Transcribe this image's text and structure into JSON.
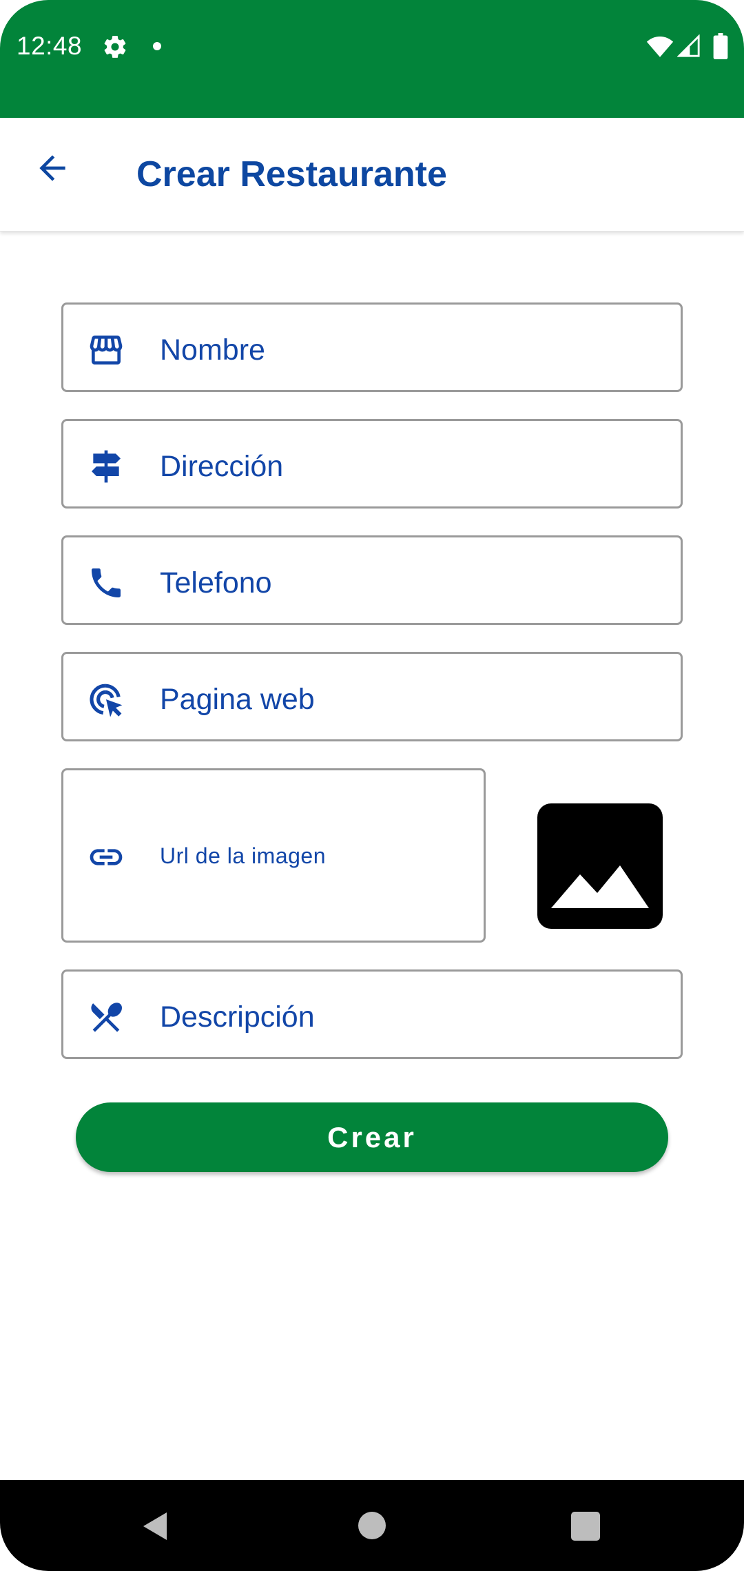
{
  "status_bar": {
    "time": "12:48",
    "icons": [
      "gear-icon",
      "notification-dot",
      "wifi-icon",
      "signal-icon",
      "battery-icon"
    ],
    "color": "#02843a"
  },
  "app_bar": {
    "title": "Crear Restaurante",
    "back_icon": "arrow-back-icon",
    "title_color": "#0d47a1"
  },
  "form": {
    "fields": [
      {
        "icon": "storefront-icon",
        "label": "Nombre"
      },
      {
        "icon": "signpost-icon",
        "label": "Dirección"
      },
      {
        "icon": "phone-icon",
        "label": "Telefono"
      },
      {
        "icon": "web-click-icon",
        "label": "Pagina web"
      },
      {
        "icon": "link-icon",
        "label": "Url de la imagen"
      },
      {
        "icon": "restaurant-icon",
        "label": "Descripción"
      }
    ],
    "image_preview_icon": "image-icon",
    "submit_label": "Crear",
    "accent_color": "#02843a",
    "label_color": "#1246a8"
  },
  "nav_bar": {
    "icons": [
      "nav-back-icon",
      "nav-home-icon",
      "nav-recents-icon"
    ]
  }
}
